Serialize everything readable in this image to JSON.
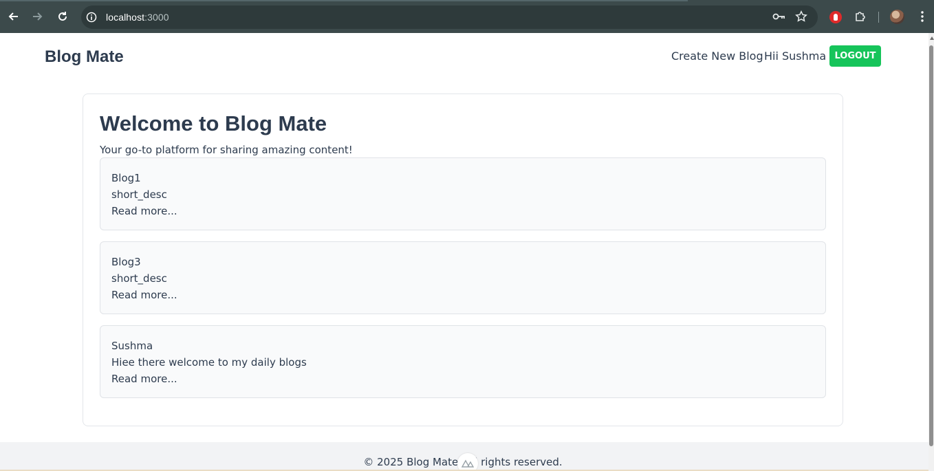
{
  "browser": {
    "url_host": "localhost",
    "url_port": ":3000"
  },
  "header": {
    "brand": "Blog Mate",
    "create_link": "Create New Blog",
    "greeting": "Hii Sushma",
    "logout": "LOGOUT"
  },
  "main": {
    "title": "Welcome to Blog Mate",
    "tagline": "Your go-to platform for sharing amazing content!",
    "blogs": [
      {
        "title": "Blog1",
        "desc": "short_desc",
        "link": "Read more..."
      },
      {
        "title": "Blog3",
        "desc": "short_desc",
        "link": "Read more..."
      },
      {
        "title": "Sushma",
        "desc": "Hiee there welcome to my daily blogs",
        "link": "Read more..."
      }
    ]
  },
  "footer": {
    "text": "© 2025 Blog Mate. All rights reserved."
  },
  "colors": {
    "chrome_bg": "#3c4a4b",
    "text_primary": "#2d3b4e",
    "logout_bg": "#16c45a",
    "footer_bg": "#f2f3f5"
  },
  "icons": [
    "back-arrow-icon",
    "forward-arrow-icon",
    "reload-icon",
    "info-icon",
    "key-icon",
    "star-icon",
    "extension-stop-icon",
    "puzzle-icon",
    "profile-avatar",
    "more-vert-icon",
    "nuxt-devtools-icon"
  ]
}
